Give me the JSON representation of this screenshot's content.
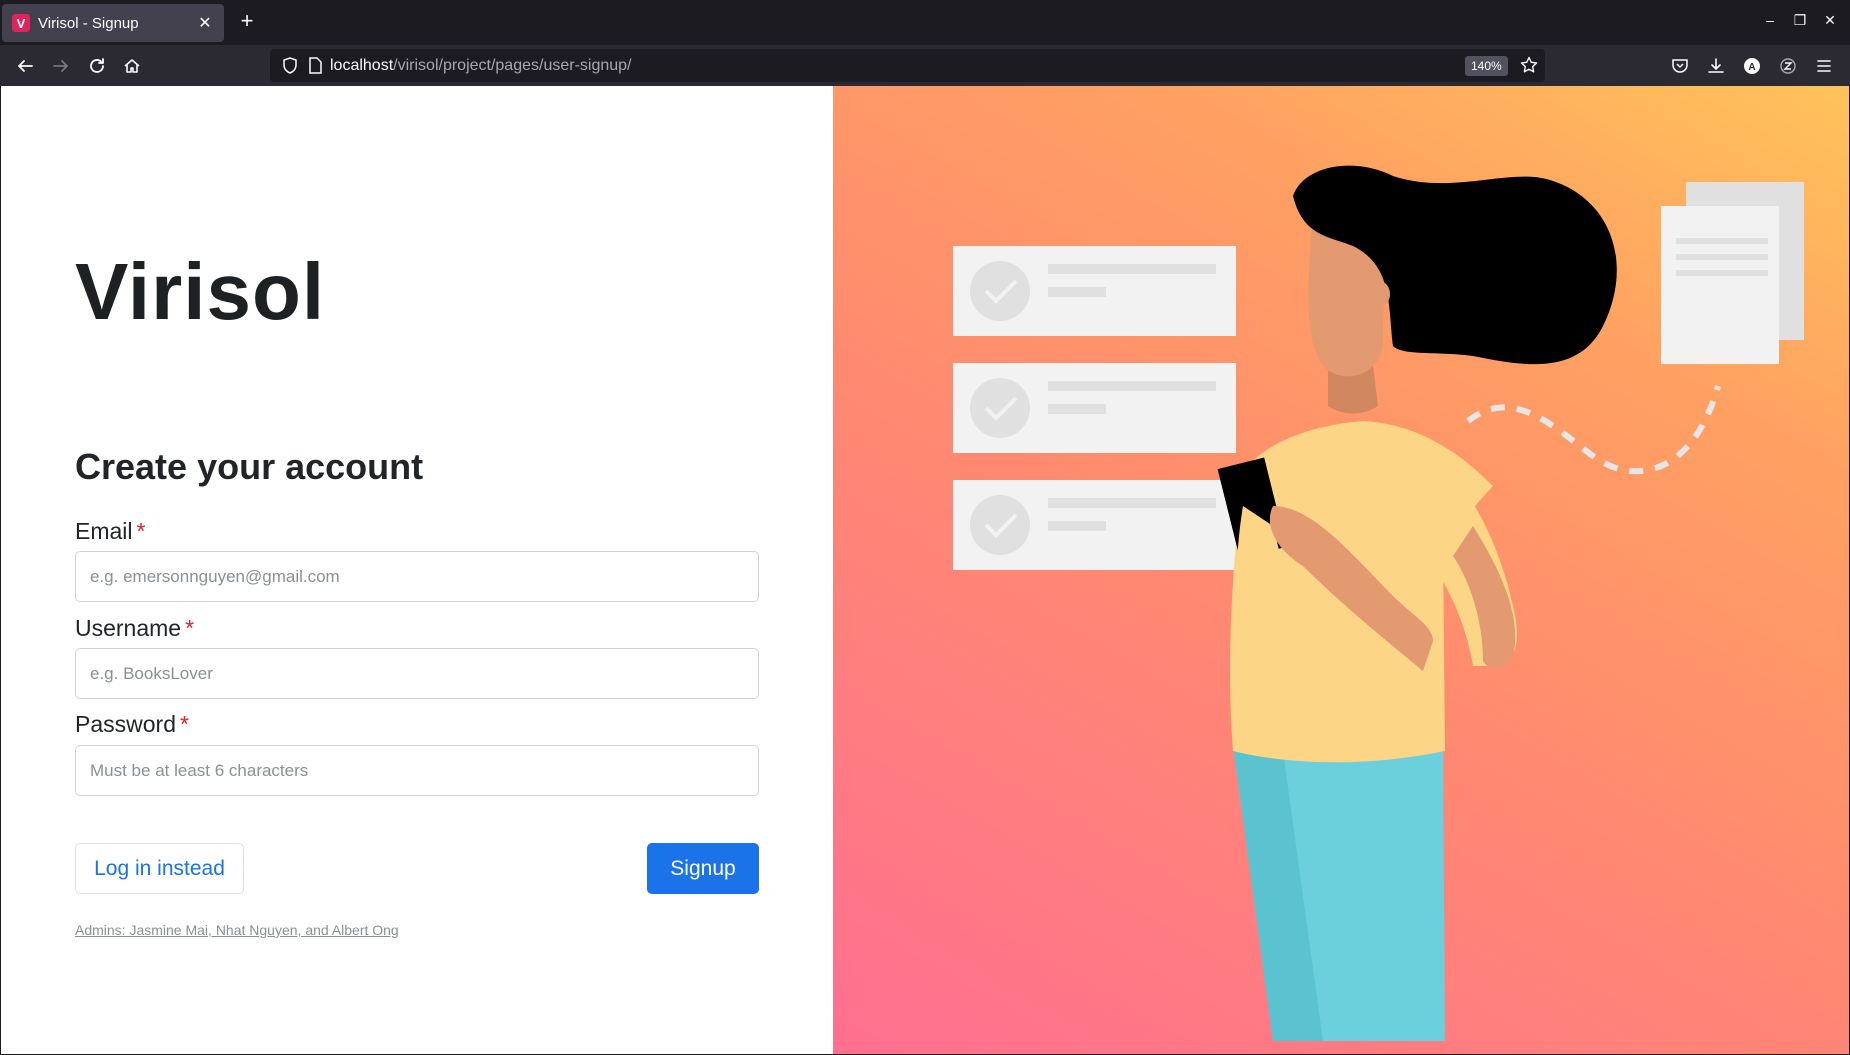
{
  "browser": {
    "tab_title": "Virisol - Signup",
    "favicon_letter": "V",
    "url_host": "localhost",
    "url_path": "/virisol/project/pages/user-signup/",
    "zoom": "140%"
  },
  "page": {
    "brand": "Virisol",
    "form_title": "Create your account",
    "fields": {
      "email": {
        "label": "Email",
        "required": "*",
        "placeholder": "e.g. emersonnguyen@gmail.com"
      },
      "username": {
        "label": "Username",
        "required": "*",
        "placeholder": "e.g. BooksLover"
      },
      "password": {
        "label": "Password",
        "required": "*",
        "placeholder": "Must be at least 6 characters"
      }
    },
    "login_label": "Log in instead",
    "signup_label": "Signup",
    "admins_text": "Admins: Jasmine Mai, Nhat Nguyen, and Albert Ong"
  },
  "colors": {
    "primary": "#1a73e8",
    "required": "#e52222",
    "gradient_start": "#ff6f91",
    "gradient_end": "#ffc35a"
  },
  "illustration": {
    "icons": [
      "checklist-card-icon",
      "document-stack-icon",
      "woman-with-phone"
    ]
  }
}
